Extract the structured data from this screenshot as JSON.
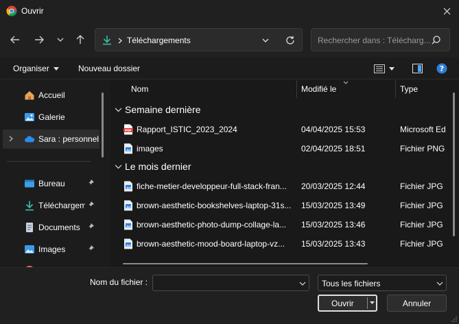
{
  "window": {
    "title": "Ouvrir",
    "close_icon": "close-icon"
  },
  "nav": {
    "back_icon": "arrow-left-icon",
    "forward_icon": "arrow-right-icon",
    "history_icon": "chevron-down-icon",
    "up_icon": "arrow-up-icon",
    "address_path": "Téléchargements",
    "search_placeholder": "Rechercher dans : Télécharg..."
  },
  "toolbar": {
    "organize_label": "Organiser",
    "new_folder_label": "Nouveau dossier"
  },
  "sidebar": {
    "items": [
      {
        "label": "Accueil",
        "icon": "home-icon"
      },
      {
        "label": "Galerie",
        "icon": "gallery-icon"
      },
      {
        "label": "Sara : personnel",
        "icon": "cloud-icon",
        "selected": true
      },
      {
        "label": "Bureau",
        "icon": "desktop-icon",
        "pinned": true
      },
      {
        "label": "Téléchargem",
        "icon": "download-icon",
        "pinned": true
      },
      {
        "label": "Documents",
        "icon": "documents-icon",
        "pinned": true
      },
      {
        "label": "Images",
        "icon": "images-icon",
        "pinned": true
      }
    ]
  },
  "columns": {
    "name": "Nom",
    "modified": "Modifié le",
    "type": "Type"
  },
  "groups": [
    {
      "title": "Semaine dernière",
      "files": [
        {
          "name": "Rapport_ISTIC_2023_2024",
          "modified": "04/04/2025 15:53",
          "type": "Microsoft Ed",
          "icon": "pdf-icon"
        },
        {
          "name": "images",
          "modified": "02/04/2025 18:51",
          "type": "Fichier PNG",
          "icon": "image-file-icon"
        }
      ]
    },
    {
      "title": "Le mois dernier",
      "files": [
        {
          "name": "fiche-metier-developpeur-full-stack-fran...",
          "modified": "20/03/2025 12:44",
          "type": "Fichier JPG",
          "icon": "image-file-icon"
        },
        {
          "name": "brown-aesthetic-bookshelves-laptop-31s...",
          "modified": "15/03/2025 13:49",
          "type": "Fichier JPG",
          "icon": "image-file-icon"
        },
        {
          "name": "brown-aesthetic-photo-dump-collage-la...",
          "modified": "15/03/2025 13:46",
          "type": "Fichier JPG",
          "icon": "image-file-icon"
        },
        {
          "name": "brown-aesthetic-mood-board-laptop-vz...",
          "modified": "15/03/2025 13:43",
          "type": "Fichier JPG",
          "icon": "image-file-icon"
        }
      ]
    }
  ],
  "footer": {
    "filename_label": "Nom du fichier :",
    "filename_value": "",
    "filter_value": "Tous les fichiers",
    "open_label": "Ouvrir",
    "cancel_label": "Annuler"
  },
  "colors": {
    "accent_download": "#3fb9a3",
    "folder_blue": "#4aa3f0",
    "pdf_red": "#d4373d"
  }
}
